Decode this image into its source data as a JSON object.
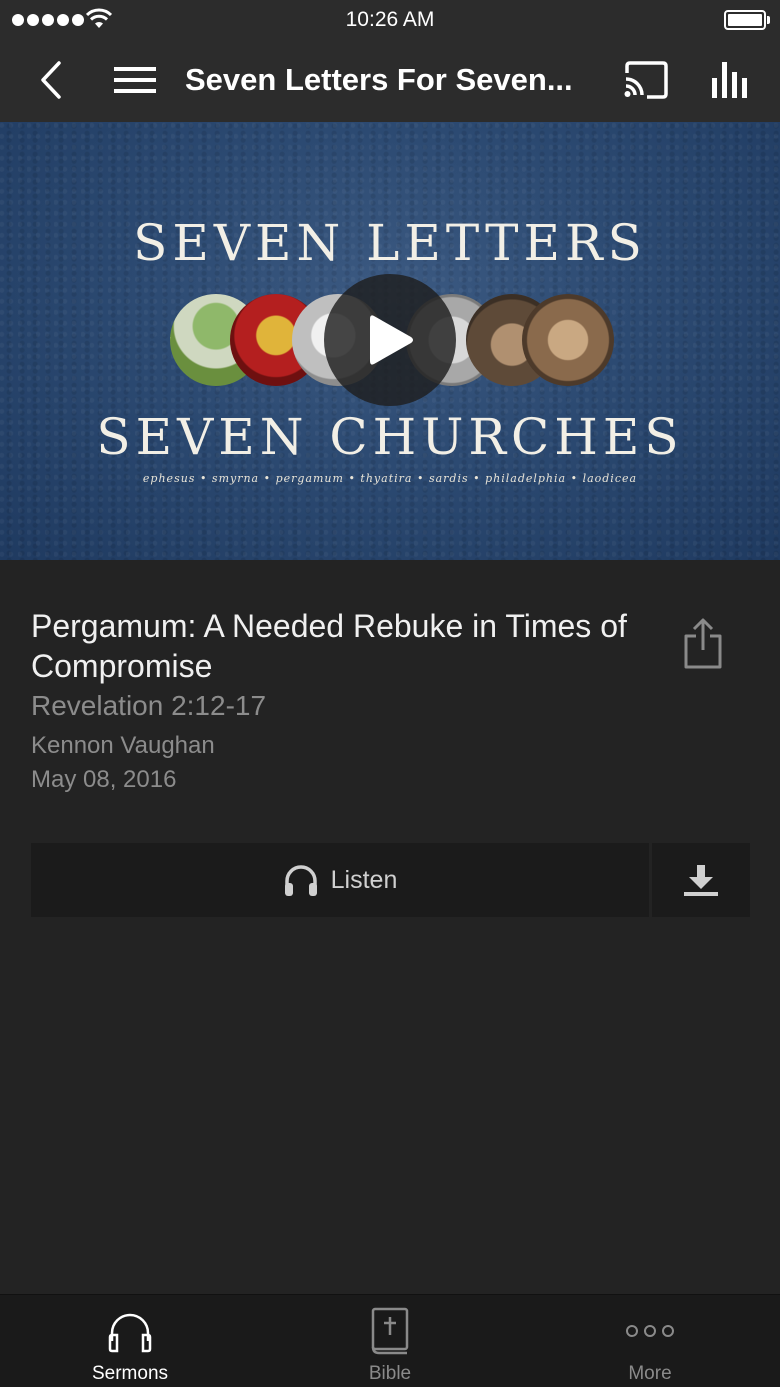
{
  "status_bar": {
    "time": "10:26 AM"
  },
  "nav": {
    "title": "Seven Letters For Seven...",
    "icons": [
      "back-chevron-icon",
      "menu-icon",
      "cast-icon",
      "stats-bars-icon"
    ]
  },
  "artwork": {
    "line1": "SEVEN LETTERS",
    "line2": "SEVEN CHURCHES",
    "cities": "ephesus • smyrna • pergamum • thyatira • sardis • philadelphia • laodicea",
    "colors": {
      "background": "#2c4a72",
      "text": "#f2efe6"
    }
  },
  "sermon": {
    "title": "Pergamum: A Needed Rebuke in Times of Compromise",
    "scripture": "Revelation 2:12-17",
    "speaker": "Kennon Vaughan",
    "date": "May 08, 2016"
  },
  "actions": {
    "listen_label": "Listen"
  },
  "tabbar": {
    "tabs": [
      {
        "label": "Sermons",
        "icon": "headphones-icon",
        "active": true
      },
      {
        "label": "Bible",
        "icon": "bible-icon",
        "active": false
      },
      {
        "label": "More",
        "icon": "more-dots-icon",
        "active": false
      }
    ]
  }
}
